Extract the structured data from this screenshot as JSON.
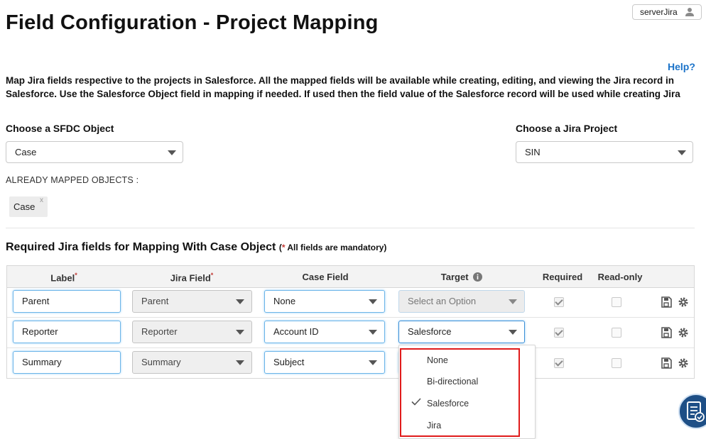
{
  "header": {
    "title": "Field Configuration - Project Mapping",
    "user_label": "serverJira",
    "help_label": "Help?"
  },
  "description": {
    "line1": "Map Jira fields respective to the projects in Salesforce. All the mapped fields will be available while creating, editing, and viewing the Jira record in",
    "line2": "Salesforce. Use the Salesforce Object field in mapping if needed. If used then the field value of the Salesforce record will be used while creating Jira"
  },
  "sfdc_object": {
    "label": "Choose a SFDC Object",
    "value": "Case"
  },
  "jira_project": {
    "label": "Choose a Jira Project",
    "value": "SIN"
  },
  "mapped_objects": {
    "label": "ALREADY MAPPED OBJECTS :",
    "chips": [
      "Case"
    ],
    "remove_glyph": "x"
  },
  "required_section": {
    "title": "Required Jira fields for Mapping With Case Object",
    "note_open": "(",
    "note_star": "*",
    "note_text": " All fields are mandatory)"
  },
  "table": {
    "headers": {
      "label": "Label",
      "jira_field": "Jira Field",
      "case_field": "Case Field",
      "target": "Target",
      "required": "Required",
      "read_only": "Read-only",
      "required_marker": "*"
    },
    "rows": [
      {
        "label": "Parent",
        "jira_field": "Parent",
        "case_field": "None",
        "target": "Select an Option",
        "required": true,
        "read_only": false
      },
      {
        "label": "Reporter",
        "jira_field": "Reporter",
        "case_field": "Account ID",
        "target": "Salesforce",
        "required": true,
        "read_only": false
      },
      {
        "label": "Summary",
        "jira_field": "Summary",
        "case_field": "Subject",
        "target": "",
        "required": true,
        "read_only": false
      }
    ]
  },
  "target_dropdown": {
    "options": [
      "None",
      "Bi-directional",
      "Salesforce",
      "Jira"
    ],
    "selected": "Salesforce"
  },
  "colors": {
    "accent": "#1b73c9",
    "focus_border": "#6bb4e8",
    "highlight_border": "#e01b1b",
    "required_star": "#c23934",
    "fab_background": "#1e4f86"
  },
  "icons": [
    "user-icon",
    "chevron-down-icon",
    "info-icon",
    "save-icon",
    "gear-icon",
    "checkmark-icon",
    "form-check-icon"
  ]
}
